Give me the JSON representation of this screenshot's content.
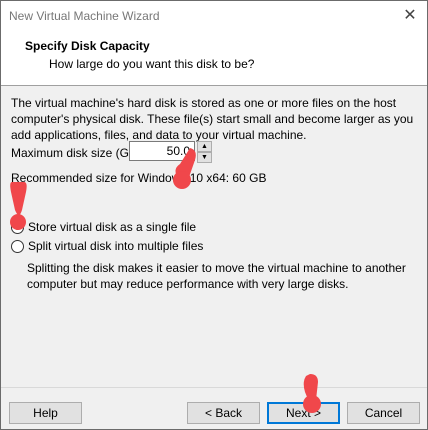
{
  "window": {
    "title": "New Virtual Machine Wizard",
    "close_glyph": "✕"
  },
  "header": {
    "title": "Specify Disk Capacity",
    "subtitle": "How large do you want this disk to be?"
  },
  "description": "The virtual machine's hard disk is stored as one or more files on the host computer's physical disk. These file(s) start small and become larger as you add applications, files, and data to your virtual machine.",
  "disk_size": {
    "label": "Maximum disk size (GB):",
    "value": "50.0",
    "up_glyph": "▲",
    "down_glyph": "▼"
  },
  "recommended": "Recommended size for Windows 10 x64: 60 GB",
  "options": {
    "single": {
      "label": "Store virtual disk as a single file",
      "checked": true
    },
    "split": {
      "label": "Split virtual disk into multiple files",
      "checked": false
    },
    "split_description": "Splitting the disk makes it easier to move the virtual machine to another computer but may reduce performance with very large disks."
  },
  "buttons": {
    "help": "Help",
    "back": "< Back",
    "next": "Next >",
    "cancel": "Cancel"
  },
  "colors": {
    "marker": "#f0474b"
  }
}
